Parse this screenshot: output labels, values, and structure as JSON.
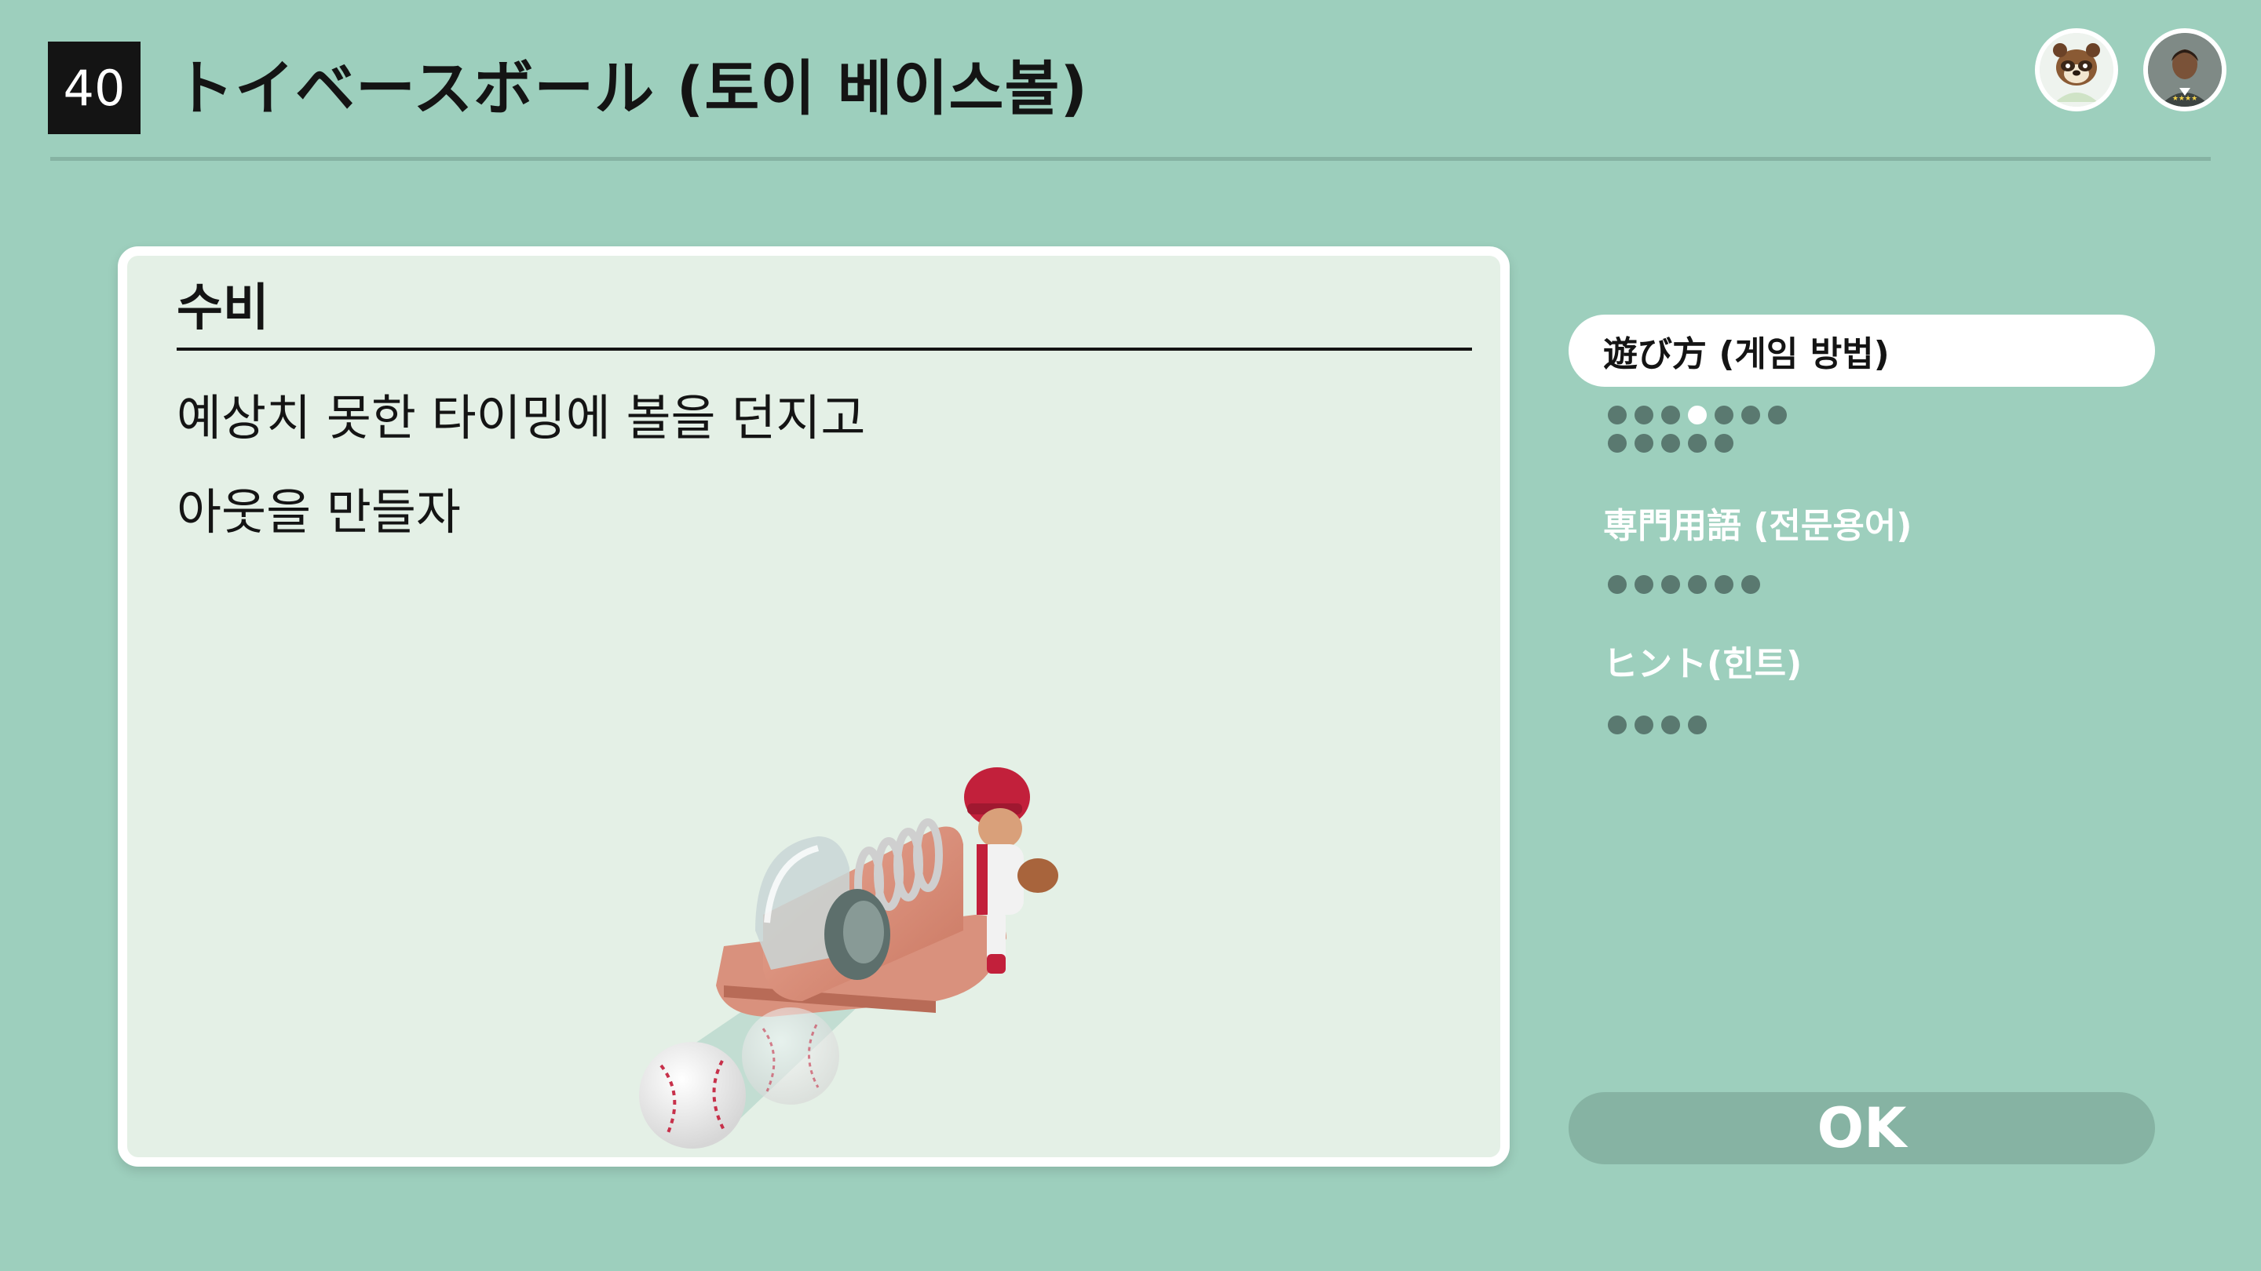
{
  "header": {
    "number": "40",
    "title": "トイベースボール (토이 베이스볼)"
  },
  "card": {
    "heading": "수비",
    "lines": [
      "예상치 못한 타이밍에 볼을 던지고",
      "아웃을 만들자"
    ]
  },
  "menu": {
    "items": [
      {
        "label": "遊び方 (게임 방법)",
        "selected": true
      },
      {
        "label": "専門用語 (전문용어)",
        "selected": false
      },
      {
        "label": "ヒント(힌트)",
        "selected": false
      }
    ]
  },
  "ok_label": "OK",
  "icons": {
    "avatar_1": "raccoon-character-avatar-icon",
    "avatar_2": "player-avatar-icon"
  },
  "colors": {
    "background": "#9dcfbd",
    "card": "#e4f0e6",
    "ok_button": "#86b3a3",
    "dot_inactive": "#5a7970",
    "dot_active": "#ffffff"
  }
}
